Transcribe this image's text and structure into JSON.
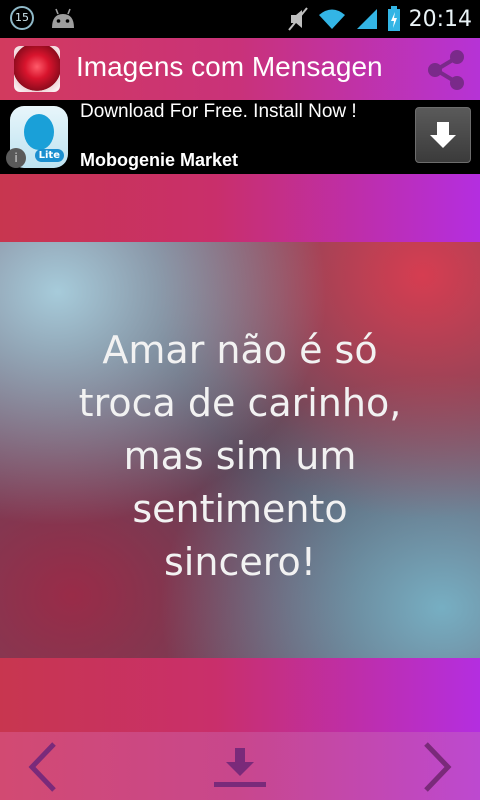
{
  "status_bar": {
    "notification_count": "15",
    "time": "20:14",
    "icons": [
      "notification-badge-icon",
      "android-icon",
      "mute-icon",
      "wifi-icon",
      "signal-icon",
      "battery-charging-icon"
    ]
  },
  "app_bar": {
    "title": "Imagens com Mensagen",
    "icons": [
      "rose-app-icon",
      "share-icon"
    ]
  },
  "ad": {
    "headline": "Download For Free. Install Now !",
    "subline": "Mobogenie Market",
    "logo_badge": "Lite",
    "info_glyph": "i",
    "icons": [
      "mobogenie-logo-icon",
      "info-icon",
      "download-arrow-icon"
    ]
  },
  "quote": {
    "lines": [
      "Amar não é só",
      "troca de carinho,",
      "mas sim um",
      "sentimento",
      "sincero!"
    ]
  },
  "bottom_nav": {
    "icons": [
      "chevron-left-icon",
      "download-icon",
      "chevron-right-icon"
    ]
  },
  "colors": {
    "gradient_left": "#c8364f",
    "gradient_right": "#b42ee0",
    "status_bar": "#000000",
    "accent_blue": "#33b5e5"
  }
}
